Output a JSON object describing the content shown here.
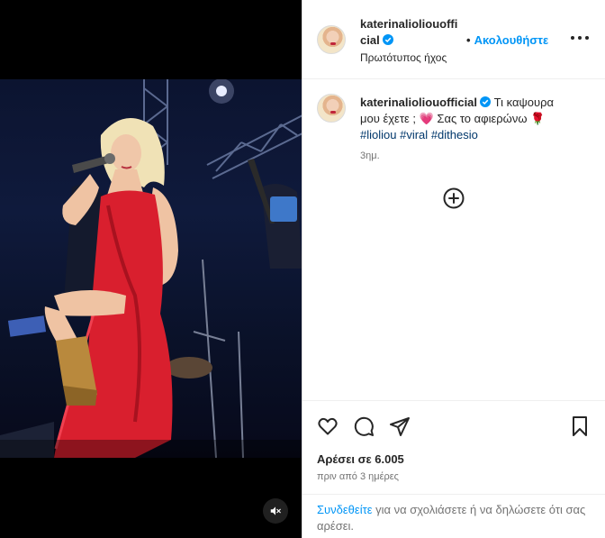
{
  "post": {
    "username": "katerinalioliouofficial",
    "follow_separator": "•",
    "follow_label": "Ακολουθήστε",
    "audio_label": "Πρωτότυπος ήχος",
    "caption_text": "Τι καψουρα μου έχετε ; 💗 Σας το αφιερώνω 🌹",
    "hashtags": [
      "#lioliou",
      "#viral",
      "#dithesio"
    ],
    "caption_time": "3ημ.",
    "likes_text": "Αρέσει σε 6.005",
    "date_text": "πριν από 3 ημέρες",
    "login_link": "Συνδεθείτε",
    "login_rest": " για να σχολιάσετε ή να δηλώσετε ότι σας αρέσει."
  },
  "icons": {
    "verified": "verified-badge-icon",
    "more": "more-options-icon",
    "add_comment": "add-comment-icon",
    "like": "heart-icon",
    "comment": "comment-icon",
    "share": "share-icon",
    "save": "bookmark-icon",
    "mute": "muted-speaker-icon"
  },
  "colors": {
    "accent": "#0095f6",
    "verified": "#0095f6",
    "hashtag": "#00376b",
    "secondary_text": "#737373",
    "dress": "#d91f2e"
  }
}
